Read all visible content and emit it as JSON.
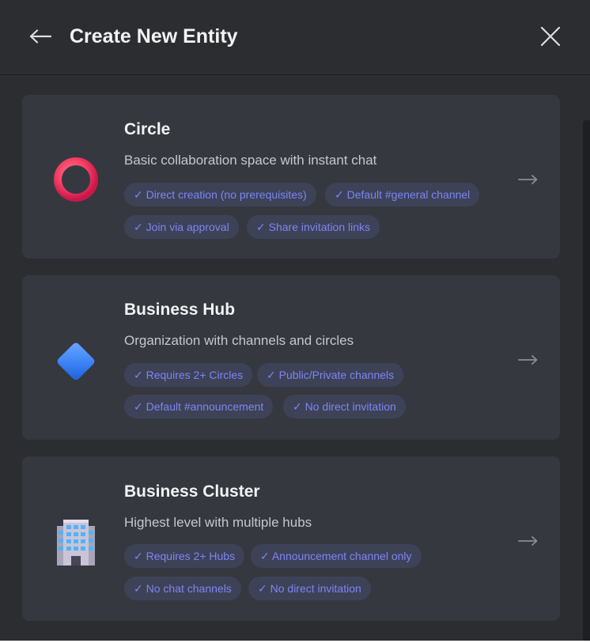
{
  "header": {
    "title": "Create New Entity",
    "back_icon": "arrow-left-icon",
    "close_icon": "close-icon"
  },
  "colors": {
    "background": "#2b2d31",
    "card": "#363840",
    "tag_bg": "#3e4257",
    "tag_text": "#7c85f3",
    "circle_icon": "#ff3d6a",
    "hub_icon": "#3b82f6"
  },
  "cards": [
    {
      "name": "Circle",
      "description": "Basic collaboration space with instant chat",
      "icon": "ring-icon",
      "tags": [
        "✓ Direct creation (no prerequisites)",
        "✓ Default #general channel",
        "✓ Join via approval",
        "✓ Share invitation links"
      ]
    },
    {
      "name": "Business Hub",
      "description": "Organization with channels and circles",
      "icon": "diamond-icon",
      "tags": [
        "✓ Requires 2+ Circles",
        "✓ Public/Private channels",
        "✓ Default #announcement",
        "✓ No direct invitation"
      ]
    },
    {
      "name": "Business Cluster",
      "description": "Highest level with multiple hubs",
      "icon": "office-building-icon",
      "tags": [
        "✓ Requires 2+ Hubs",
        "✓ Announcement channel only",
        "✓ No chat channels",
        "✓ No direct invitation"
      ]
    }
  ]
}
